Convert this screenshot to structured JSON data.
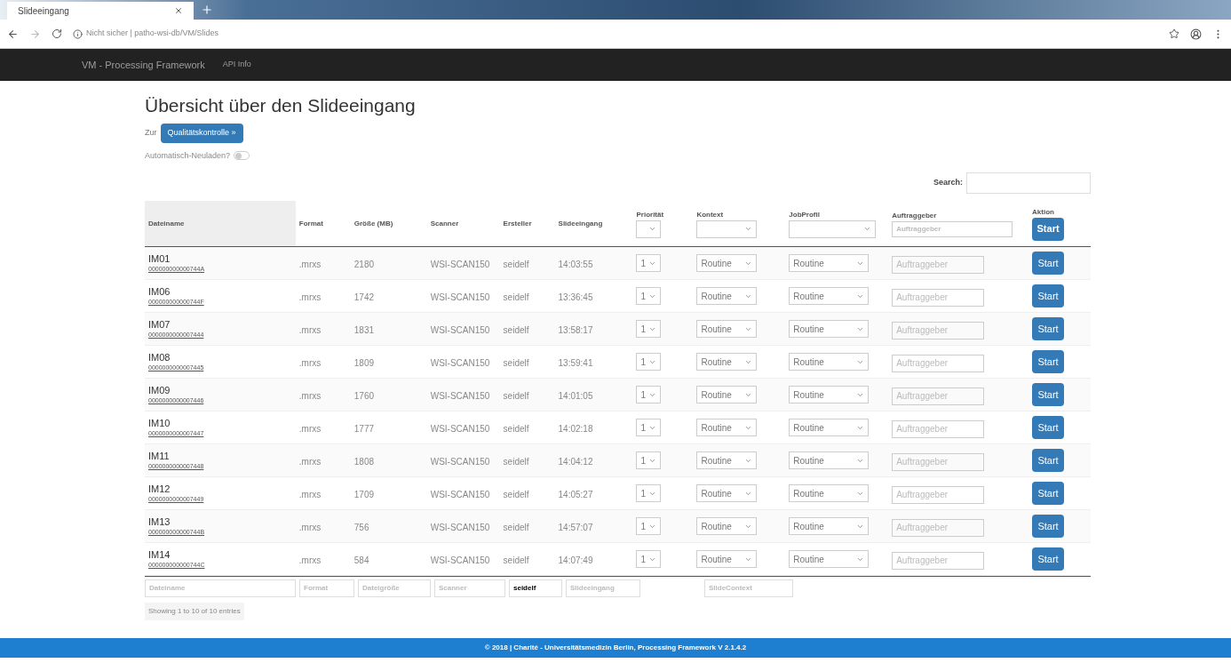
{
  "browser": {
    "tab_title": "Slideeingang",
    "address": "Nicht sicher | patho-wsi-db/VM/Slides"
  },
  "navbar": {
    "brand": "VM - Processing Framework",
    "links": [
      "API Info"
    ]
  },
  "page": {
    "title": "Übersicht über den Slideeingang",
    "goto_label": "Zur",
    "goto_button": "Qualitätskontrolle »",
    "autoreload_label": "Automatisch-Neuladen?",
    "autoreload_on": false
  },
  "search": {
    "label": "Search:"
  },
  "table": {
    "columns": [
      {
        "label": "Dateiname",
        "kind": "text",
        "sorted": true
      },
      {
        "label": "Format",
        "kind": "text",
        "sorted": false
      },
      {
        "label": "Größe (MB)",
        "kind": "text",
        "sorted": false
      },
      {
        "label": "Scanner",
        "kind": "text",
        "sorted": false
      },
      {
        "label": "Ersteller",
        "kind": "text",
        "sorted": false
      },
      {
        "label": "Slideeingang",
        "kind": "text",
        "sorted": false
      },
      {
        "label": "Priorität",
        "kind": "select",
        "sorted": false
      },
      {
        "label": "Kontext",
        "kind": "select",
        "sorted": false
      },
      {
        "label": "JobProfil",
        "kind": "select",
        "sorted": false
      },
      {
        "label": "Auftraggeber",
        "kind": "input",
        "placeholder": "Auftraggeber",
        "sorted": false
      },
      {
        "label": "Aktion",
        "kind": "button",
        "button": "Start",
        "sorted": false
      }
    ],
    "rows": [
      {
        "name": "IM01",
        "id": "000000000000744A",
        "format": ".mrxs",
        "size": "2180",
        "scanner": "WSI-SCAN150",
        "creator": "seidelf",
        "received": "14:03:55",
        "priority": "1",
        "context": "Routine",
        "job_profile": "Routine",
        "client_placeholder": "Auftraggeber",
        "action": "Start"
      },
      {
        "name": "IM06",
        "id": "000000000000744F",
        "format": ".mrxs",
        "size": "1742",
        "scanner": "WSI-SCAN150",
        "creator": "seidelf",
        "received": "13:36:45",
        "priority": "1",
        "context": "Routine",
        "job_profile": "Routine",
        "client_placeholder": "Auftraggeber",
        "action": "Start"
      },
      {
        "name": "IM07",
        "id": "0000000000007444",
        "format": ".mrxs",
        "size": "1831",
        "scanner": "WSI-SCAN150",
        "creator": "seidelf",
        "received": "13:58:17",
        "priority": "1",
        "context": "Routine",
        "job_profile": "Routine",
        "client_placeholder": "Auftraggeber",
        "action": "Start"
      },
      {
        "name": "IM08",
        "id": "0000000000007445",
        "format": ".mrxs",
        "size": "1809",
        "scanner": "WSI-SCAN150",
        "creator": "seidelf",
        "received": "13:59:41",
        "priority": "1",
        "context": "Routine",
        "job_profile": "Routine",
        "client_placeholder": "Auftraggeber",
        "action": "Start"
      },
      {
        "name": "IM09",
        "id": "0000000000007446",
        "format": ".mrxs",
        "size": "1760",
        "scanner": "WSI-SCAN150",
        "creator": "seidelf",
        "received": "14:01:05",
        "priority": "1",
        "context": "Routine",
        "job_profile": "Routine",
        "client_placeholder": "Auftraggeber",
        "action": "Start"
      },
      {
        "name": "IM10",
        "id": "0000000000007447",
        "format": ".mrxs",
        "size": "1777",
        "scanner": "WSI-SCAN150",
        "creator": "seidelf",
        "received": "14:02:18",
        "priority": "1",
        "context": "Routine",
        "job_profile": "Routine",
        "client_placeholder": "Auftraggeber",
        "action": "Start"
      },
      {
        "name": "IM11",
        "id": "0000000000007448",
        "format": ".mrxs",
        "size": "1808",
        "scanner": "WSI-SCAN150",
        "creator": "seidelf",
        "received": "14:04:12",
        "priority": "1",
        "context": "Routine",
        "job_profile": "Routine",
        "client_placeholder": "Auftraggeber",
        "action": "Start"
      },
      {
        "name": "IM12",
        "id": "0000000000007449",
        "format": ".mrxs",
        "size": "1709",
        "scanner": "WSI-SCAN150",
        "creator": "seidelf",
        "received": "14:05:27",
        "priority": "1",
        "context": "Routine",
        "job_profile": "Routine",
        "client_placeholder": "Auftraggeber",
        "action": "Start"
      },
      {
        "name": "IM13",
        "id": "000000000000744B",
        "format": ".mrxs",
        "size": "756",
        "scanner": "WSI-SCAN150",
        "creator": "seidelf",
        "received": "14:57:07",
        "priority": "1",
        "context": "Routine",
        "job_profile": "Routine",
        "client_placeholder": "Auftraggeber",
        "action": "Start"
      },
      {
        "name": "IM14",
        "id": "000000000000744C",
        "format": ".mrxs",
        "size": "584",
        "scanner": "WSI-SCAN150",
        "creator": "seidelf",
        "received": "14:07:49",
        "priority": "1",
        "context": "Routine",
        "job_profile": "Routine",
        "client_placeholder": "Auftraggeber",
        "action": "Start"
      }
    ],
    "filters": [
      {
        "kind": "field",
        "placeholder": "Dateiname"
      },
      {
        "kind": "field",
        "placeholder": "Format"
      },
      {
        "kind": "field",
        "placeholder": "Dateigröße"
      },
      {
        "kind": "field",
        "placeholder": "Scanner"
      },
      {
        "kind": "field",
        "value": "seidelf"
      },
      {
        "kind": "field",
        "placeholder": "Slideeingang"
      },
      {
        "kind": "empty"
      },
      {
        "kind": "field",
        "placeholder": "SlideContext"
      }
    ],
    "info": "Showing 1 to 10 of 10 entries"
  },
  "footer": "© 2018 | Charité - Universitätsmedizin Berlin, Processing Framework V 2.1.4.2"
}
